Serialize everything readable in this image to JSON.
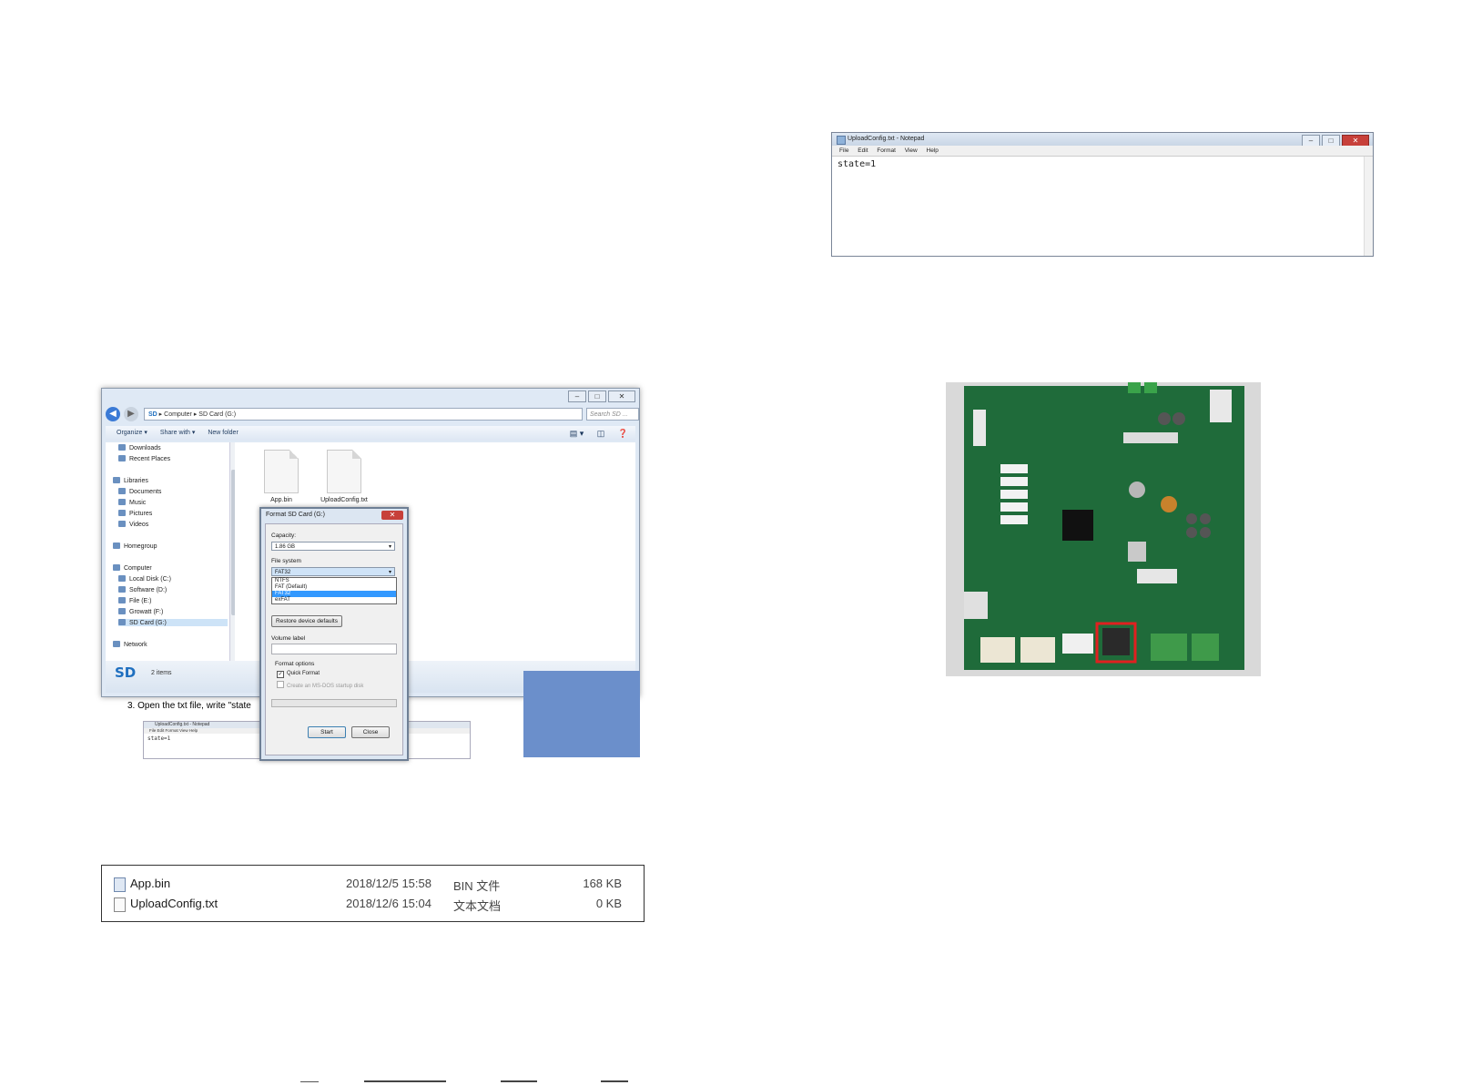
{
  "explorer": {
    "address": [
      "Computer",
      "SD Card (G:)"
    ],
    "search_placeholder": "Search SD ...",
    "toolbar": [
      "Organize ▾",
      "Share with ▾",
      "New folder"
    ],
    "nav_items": [
      {
        "label": "Downloads"
      },
      {
        "label": "Recent Places"
      },
      {
        "label": "Libraries"
      },
      {
        "label": "Documents"
      },
      {
        "label": "Music"
      },
      {
        "label": "Pictures"
      },
      {
        "label": "Videos"
      },
      {
        "label": "Homegroup"
      },
      {
        "label": "Computer"
      },
      {
        "label": "Local Disk (C:)"
      },
      {
        "label": "Software (D:)"
      },
      {
        "label": "File (E:)"
      },
      {
        "label": "Growatt (F:)"
      },
      {
        "label": "SD Card (G:)"
      },
      {
        "label": "Network"
      }
    ],
    "files": [
      "App.bin",
      "UploadConfig.txt"
    ],
    "status_logo": "SD",
    "status_items": "2 items"
  },
  "format_dialog": {
    "title": "Format SD Card (G:)",
    "capacity_label": "Capacity:",
    "capacity_value": "1.86 GB",
    "filesystem_label": "File system",
    "filesystem_value": "FAT32",
    "filesystem_options": [
      "NTFS",
      "FAT (Default)",
      "FAT32",
      "exFAT"
    ],
    "restore_button": "Restore device defaults",
    "volume_label": "Volume label",
    "format_options_label": "Format options",
    "quick_format": "Quick Format",
    "msdos_disk": "Create an MS-DOS startup disk",
    "start_button": "Start",
    "close_button": "Close"
  },
  "step_text": "3.  Open the txt file, write \"state",
  "mini_notepad": {
    "title": "UploadConfig.txt - Notepad",
    "menu": "File  Edit  Format  View  Help",
    "text": "state=1"
  },
  "file_list": [
    {
      "name": "App.bin",
      "date": "2018/12/5 15:58",
      "type": "BIN 文件",
      "size": "168 KB"
    },
    {
      "name": "UploadConfig.txt",
      "date": "2018/12/6 15:04",
      "type": "文本文档",
      "size": "0 KB"
    }
  ],
  "notepad": {
    "title": "UploadConfig.txt - Notepad",
    "menu": [
      "File",
      "Edit",
      "Format",
      "View",
      "Help"
    ],
    "text": "state=1"
  },
  "colors": {
    "highlight": "#e02020",
    "board": "#1f6b3a",
    "selection": "#3399ff"
  }
}
